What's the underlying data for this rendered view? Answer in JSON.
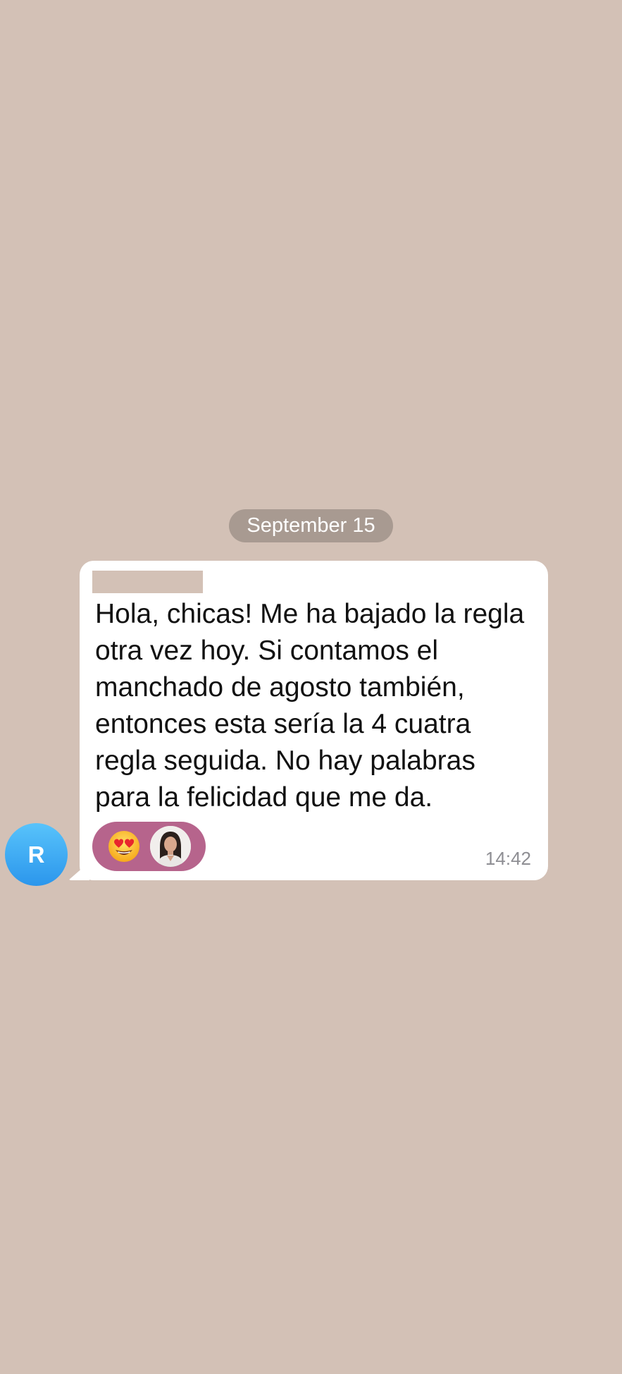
{
  "chat": {
    "date_separator": "September 15",
    "message": {
      "sender_initial": "R",
      "text": "Hola, chicas! Me ha bajado la regla\notra vez hoy. Si contamos el\nmanchado de agosto también,\nentonces esta sería la 4 cuatra\nregla seguida. No hay palabras\npara la felicidad que me da.",
      "time": "14:42",
      "reaction": {
        "emoji_icon": "heart-eyes-emoji-icon",
        "reactor_icon": "reactor-photo-avatar"
      }
    }
  },
  "colors": {
    "background": "#d3c1b6",
    "date_pill": "#a89a91",
    "bubble": "#ffffff",
    "reaction_pill": "#b6648c",
    "avatar_gradient_top": "#58c3fb",
    "avatar_gradient_bottom": "#2b96ec"
  }
}
